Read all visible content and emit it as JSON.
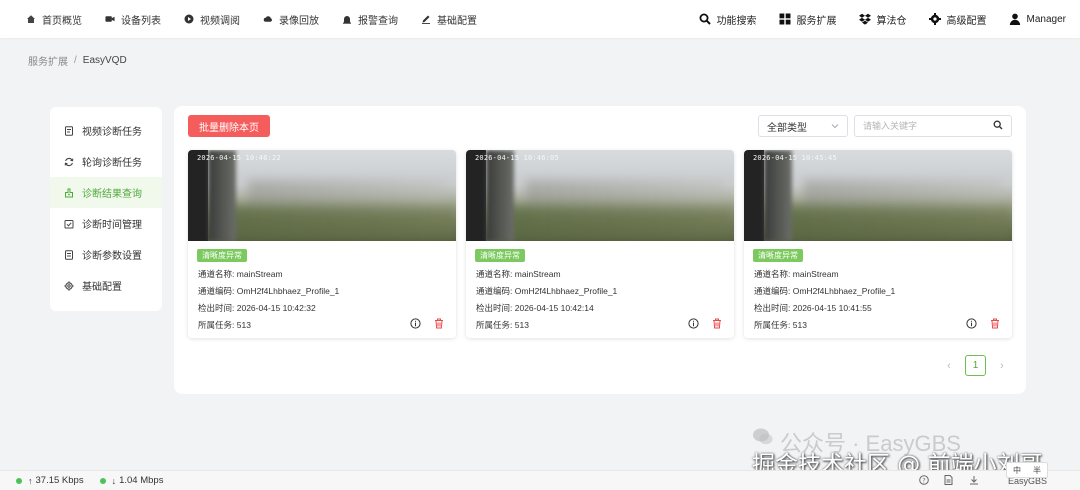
{
  "topnav": {
    "left": [
      {
        "label": "首页概览",
        "icon": "home-icon"
      },
      {
        "label": "设备列表",
        "icon": "camera-icon"
      },
      {
        "label": "视频调阅",
        "icon": "play-circle-icon"
      },
      {
        "label": "录像回放",
        "icon": "cloud-icon"
      },
      {
        "label": "报警查询",
        "icon": "alarm-icon"
      },
      {
        "label": "基础配置",
        "icon": "edit-icon"
      }
    ],
    "right": [
      {
        "label": "功能搜索",
        "icon": "search-icon"
      },
      {
        "label": "服务扩展",
        "icon": "grid-icon"
      },
      {
        "label": "算法仓",
        "icon": "dropbox-icon"
      },
      {
        "label": "高级配置",
        "icon": "gear-icon"
      },
      {
        "label": "Manager",
        "icon": "user-icon"
      }
    ]
  },
  "breadcrumb": {
    "parent": "服务扩展",
    "separator": "/",
    "current": "EasyVQD"
  },
  "sidebar": {
    "items": [
      {
        "label": "视频诊断任务",
        "icon": "task-doc-icon",
        "active": false
      },
      {
        "label": "轮询诊断任务",
        "icon": "refresh-icon",
        "active": false
      },
      {
        "label": "诊断结果查询",
        "icon": "result-icon",
        "active": true
      },
      {
        "label": "诊断时间管理",
        "icon": "calendar-check-icon",
        "active": false
      },
      {
        "label": "诊断参数设置",
        "icon": "params-doc-icon",
        "active": false
      },
      {
        "label": "基础配置",
        "icon": "gear-icon",
        "active": false
      }
    ]
  },
  "toolbar": {
    "batch_delete_label": "批量删除本页",
    "type_select_value": "全部类型",
    "search_placeholder": "请输入关键字"
  },
  "field_labels": {
    "channel_name": "通道名称:",
    "channel_code": "通道编码:",
    "detect_time": "检出时间:",
    "task": "所属任务:"
  },
  "cards": [
    {
      "timestamp": "2026-04-15  10:46:22",
      "tag": "清晰度异常",
      "channel_name": "mainStream",
      "channel_code": "OmH2f4Lhbhaez_Profile_1",
      "detect_time": "2026-04-15 10:42:32",
      "task": "513"
    },
    {
      "timestamp": "2026-04-15  10:46:05",
      "tag": "清晰度异常",
      "channel_name": "mainStream",
      "channel_code": "OmH2f4Lhbhaez_Profile_1",
      "detect_time": "2026-04-15 10:42:14",
      "task": "513"
    },
    {
      "timestamp": "2026-04-15  10:45:45",
      "tag": "清晰度异常",
      "channel_name": "mainStream",
      "channel_code": "OmH2f4Lhbhaez_Profile_1",
      "detect_time": "2026-04-15 10:41:55",
      "task": "513"
    }
  ],
  "pagination": {
    "current_page": "1",
    "prev": "‹",
    "next": "›"
  },
  "statusbar": {
    "upload": "37.15 Kbps",
    "download": "1.04 Mbps",
    "brand": "EasyGBS",
    "status_color": "#4cc25a"
  },
  "watermark": {
    "line1": "公众号 · EasyGBS",
    "line2": "掘金技术社区 @ 前端小刘哥"
  },
  "ime": {
    "label1": "中",
    "label2": "半"
  },
  "colors": {
    "accent": "#4fa83d",
    "danger": "#f55d5d",
    "tag": "#7cc95f"
  }
}
